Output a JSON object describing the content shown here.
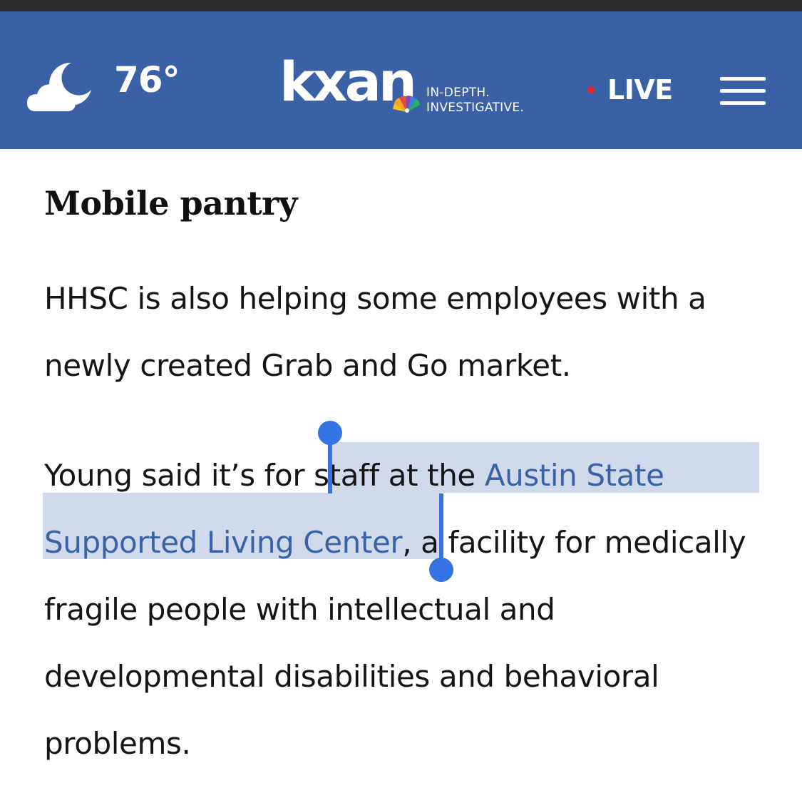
{
  "header": {
    "temperature": "76°",
    "logo": "kxan",
    "tagline_line1": "IN-DEPTH.",
    "tagline_line2": "INVESTIGATIVE.",
    "live_label": "LIVE",
    "colors": {
      "header_bg": "#3a60a6",
      "live_dot": "#e5262b",
      "link": "#3a63a7",
      "selection_handle": "#3473e2"
    },
    "icons": [
      "cloud-moon-icon",
      "peacock-icon",
      "menu-icon"
    ]
  },
  "article": {
    "section_title": "Mobile pantry",
    "paragraph1": "HHSC is also helping some employees with a newly created Grab and Go market.",
    "paragraph2": {
      "before": "Young said it’s for ",
      "selected_text": "staff at the ",
      "link_text": "Austin State Supported Living Center",
      "after": ", a facility for medically fragile people with intellectual and developmental disabilities and behavioral problems."
    }
  }
}
